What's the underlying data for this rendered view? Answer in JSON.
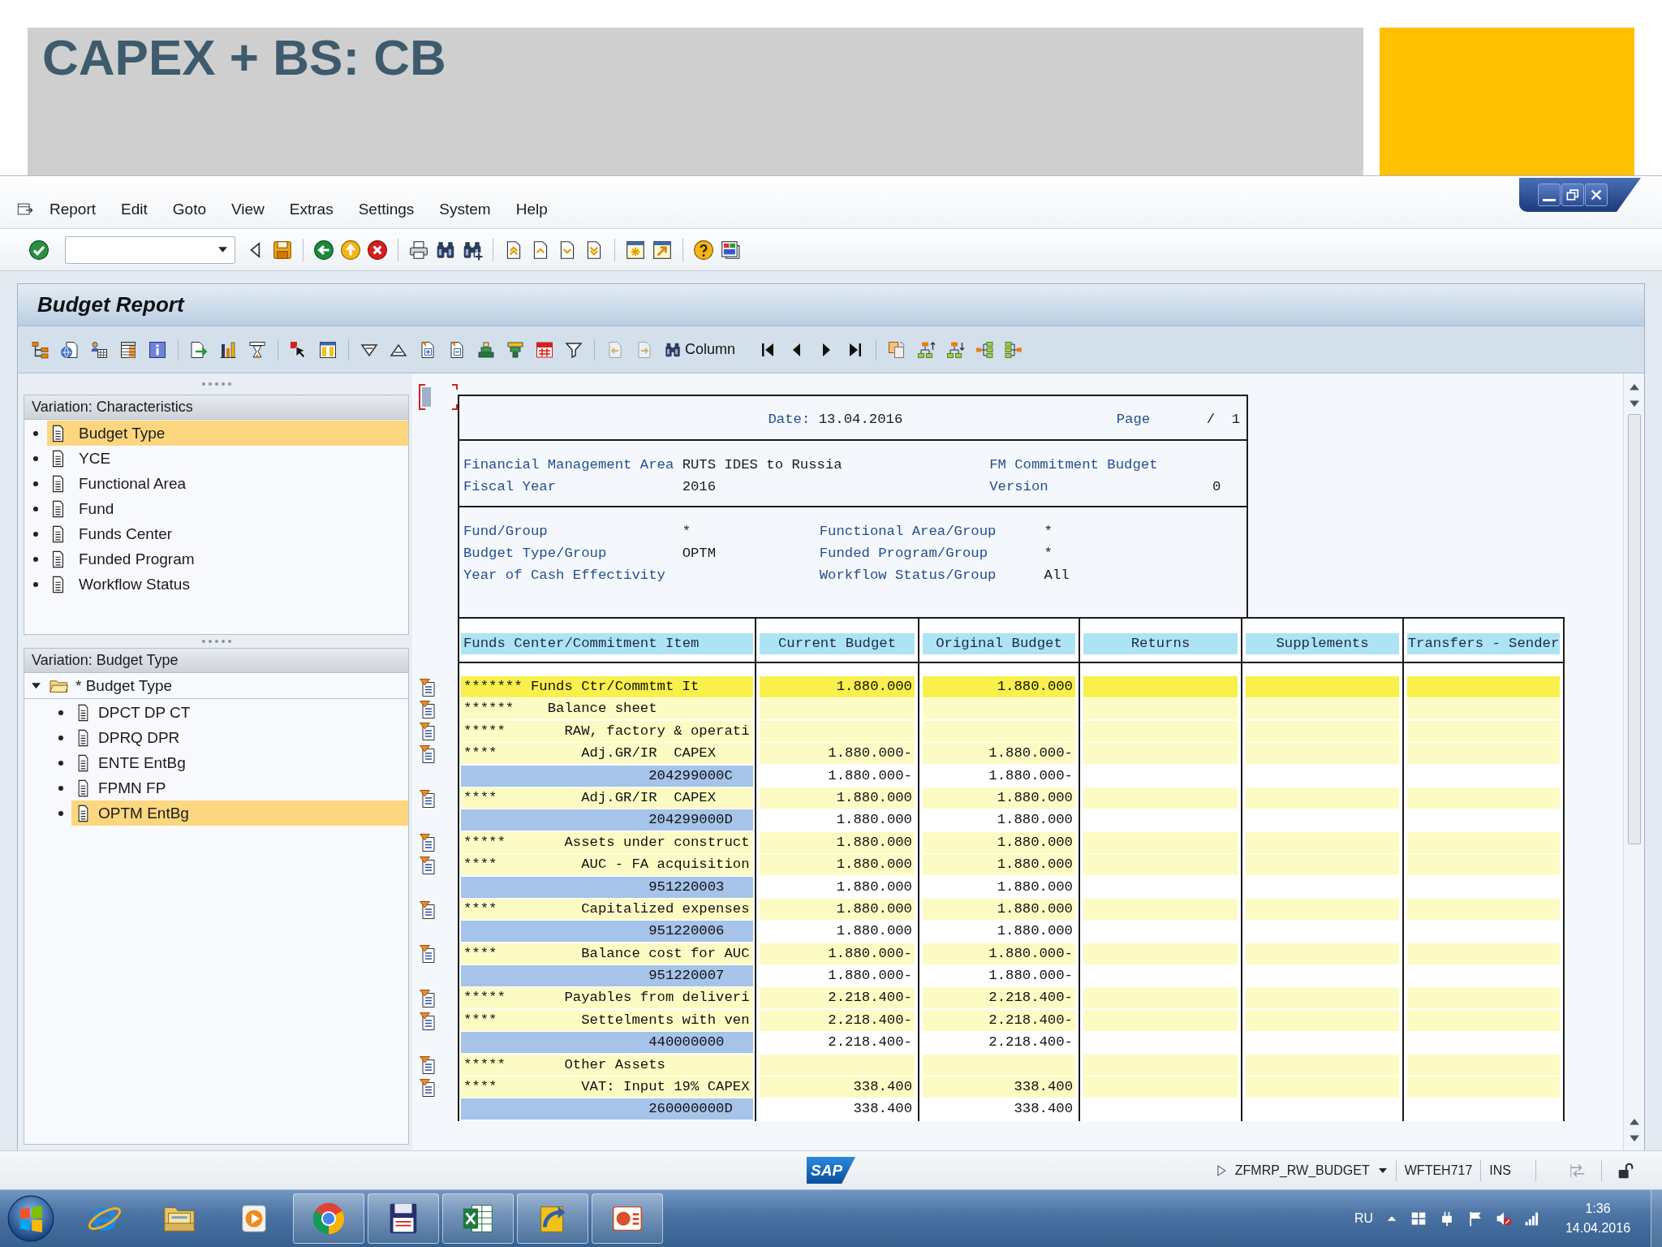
{
  "slide": {
    "title": "CAPEX + BS: CB"
  },
  "menu": [
    "Report",
    "Edit",
    "Goto",
    "View",
    "Extras",
    "Settings",
    "System",
    "Help"
  ],
  "panel": {
    "title": "Budget Report",
    "column_button": "Column"
  },
  "characteristics": {
    "title": "Variation: Characteristics",
    "items": [
      {
        "label": "Budget Type",
        "selected": true
      },
      {
        "label": "YCE",
        "selected": false
      },
      {
        "label": "Functional Area",
        "selected": false
      },
      {
        "label": "Fund",
        "selected": false
      },
      {
        "label": "Funds Center",
        "selected": false
      },
      {
        "label": "Funded Program",
        "selected": false
      },
      {
        "label": "Workflow Status",
        "selected": false
      }
    ]
  },
  "budget_types": {
    "title": "Variation: Budget Type",
    "root": {
      "label": "* Budget Type",
      "expanded": true,
      "selected": false,
      "children": [
        {
          "label": "DPCT DP CT",
          "selected": false
        },
        {
          "label": "DPRQ DPR",
          "selected": false
        },
        {
          "label": "ENTE EntBg",
          "selected": false
        },
        {
          "label": "FPMN FP",
          "selected": false
        },
        {
          "label": "OPTM EntBg",
          "selected": true
        }
      ]
    }
  },
  "report": {
    "date": {
      "label": "Date:",
      "value": "13.04.2016"
    },
    "page": {
      "label": "Page",
      "value": "/  1"
    },
    "summary": [
      {
        "label": "Financial Management Area",
        "value": "RUTS IDES to Russia",
        "label_2": "FM Commitment Budget"
      },
      {
        "label": "Fiscal Year",
        "value": "2016",
        "label_2": "Version",
        "value_2": "0"
      }
    ],
    "selections": [
      {
        "label": "Fund/Group",
        "value": "*",
        "label_2": "Functional Area/Group",
        "value_2": "*"
      },
      {
        "label": "Budget Type/Group",
        "value": "OPTM",
        "label_2": "Funded Program/Group",
        "value_2": "*"
      },
      {
        "label": "Year of Cash Effectivity",
        "label_2": "Workflow Status/Group",
        "value_2": "All"
      }
    ],
    "table": {
      "columns": [
        "Funds Center/Commitment Item",
        "Current Budget",
        "Original Budget",
        "Returns",
        "Supplements",
        "Transfers - Sender"
      ],
      "rows": [
        {
          "kind": "total",
          "asterisks": "*******",
          "label": "Funds Ctr/Commtmt It",
          "values": [
            "1.880.000",
            "1.880.000"
          ],
          "children": [
            {
              "kind": "node",
              "asterisks": "******",
              "label": "Balance sheet",
              "children": [
                {
                  "kind": "node",
                  "asterisks": "*****",
                  "label": "RAW, factory & operati",
                  "children": [
                    {
                      "kind": "node",
                      "asterisks": "****",
                      "label": "Adj.GR/IR  CAPEX",
                      "values": [
                        "1.880.000-",
                        "1.880.000-"
                      ],
                      "children": [
                        {
                          "kind": "item",
                          "label": "204299000C",
                          "values": [
                            "1.880.000-",
                            "1.880.000-"
                          ]
                        }
                      ]
                    },
                    {
                      "kind": "node",
                      "asterisks": "****",
                      "label": "Adj.GR/IR  CAPEX",
                      "values": [
                        "1.880.000",
                        "1.880.000"
                      ],
                      "children": [
                        {
                          "kind": "item",
                          "label": "204299000D",
                          "values": [
                            "1.880.000",
                            "1.880.000"
                          ]
                        }
                      ]
                    }
                  ]
                },
                {
                  "kind": "node",
                  "asterisks": "*****",
                  "label": "Assets under construct",
                  "values": [
                    "1.880.000",
                    "1.880.000"
                  ],
                  "children": [
                    {
                      "kind": "node",
                      "asterisks": "****",
                      "label": "AUC - FA acquisition",
                      "values": [
                        "1.880.000",
                        "1.880.000"
                      ],
                      "children": [
                        {
                          "kind": "item",
                          "label": "951220003",
                          "values": [
                            "1.880.000",
                            "1.880.000"
                          ]
                        }
                      ]
                    },
                    {
                      "kind": "node",
                      "asterisks": "****",
                      "label": "Capitalized expenses",
                      "values": [
                        "1.880.000",
                        "1.880.000"
                      ],
                      "children": [
                        {
                          "kind": "item",
                          "label": "951220006",
                          "values": [
                            "1.880.000",
                            "1.880.000"
                          ]
                        }
                      ]
                    },
                    {
                      "kind": "node",
                      "asterisks": "****",
                      "label": "Balance cost for AUC",
                      "values": [
                        "1.880.000-",
                        "1.880.000-"
                      ],
                      "children": [
                        {
                          "kind": "item",
                          "label": "951220007",
                          "values": [
                            "1.880.000-",
                            "1.880.000-"
                          ]
                        }
                      ]
                    }
                  ]
                },
                {
                  "kind": "node",
                  "asterisks": "*****",
                  "label": "Payables from deliveri",
                  "values": [
                    "2.218.400-",
                    "2.218.400-"
                  ],
                  "children": [
                    {
                      "kind": "node",
                      "asterisks": "****",
                      "label": "Settelments with ven",
                      "values": [
                        "2.218.400-",
                        "2.218.400-"
                      ],
                      "children": [
                        {
                          "kind": "item",
                          "label": "440000000",
                          "values": [
                            "2.218.400-",
                            "2.218.400-"
                          ]
                        }
                      ]
                    }
                  ]
                },
                {
                  "kind": "node",
                  "asterisks": "*****",
                  "label": "Other Assets",
                  "children": [
                    {
                      "kind": "node",
                      "asterisks": "****",
                      "label": "VAT: Input 19% CAPEX",
                      "values": [
                        "338.400",
                        "338.400"
                      ],
                      "children": [
                        {
                          "kind": "item",
                          "label": "260000000D",
                          "values": [
                            "338.400",
                            "338.400"
                          ]
                        }
                      ]
                    }
                  ]
                }
              ]
            }
          ]
        }
      ]
    }
  },
  "status_bar": {
    "logo": "SAP",
    "program": "ZFMRP_RW_BUDGET",
    "system": "WFTEH717",
    "mode": "INS"
  },
  "taskbar": {
    "apps": [
      {
        "kind": "orbit",
        "running": false
      },
      {
        "kind": "folder",
        "running": false
      },
      {
        "kind": "player",
        "running": false
      },
      {
        "kind": "wheel",
        "running": true
      },
      {
        "kind": "disk",
        "running": true
      },
      {
        "kind": "sheet",
        "running": true
      },
      {
        "kind": "arrow",
        "running": true
      },
      {
        "kind": "slides",
        "running": true
      }
    ],
    "language": "RU",
    "time": "1:36",
    "date": "14.04.2016"
  }
}
